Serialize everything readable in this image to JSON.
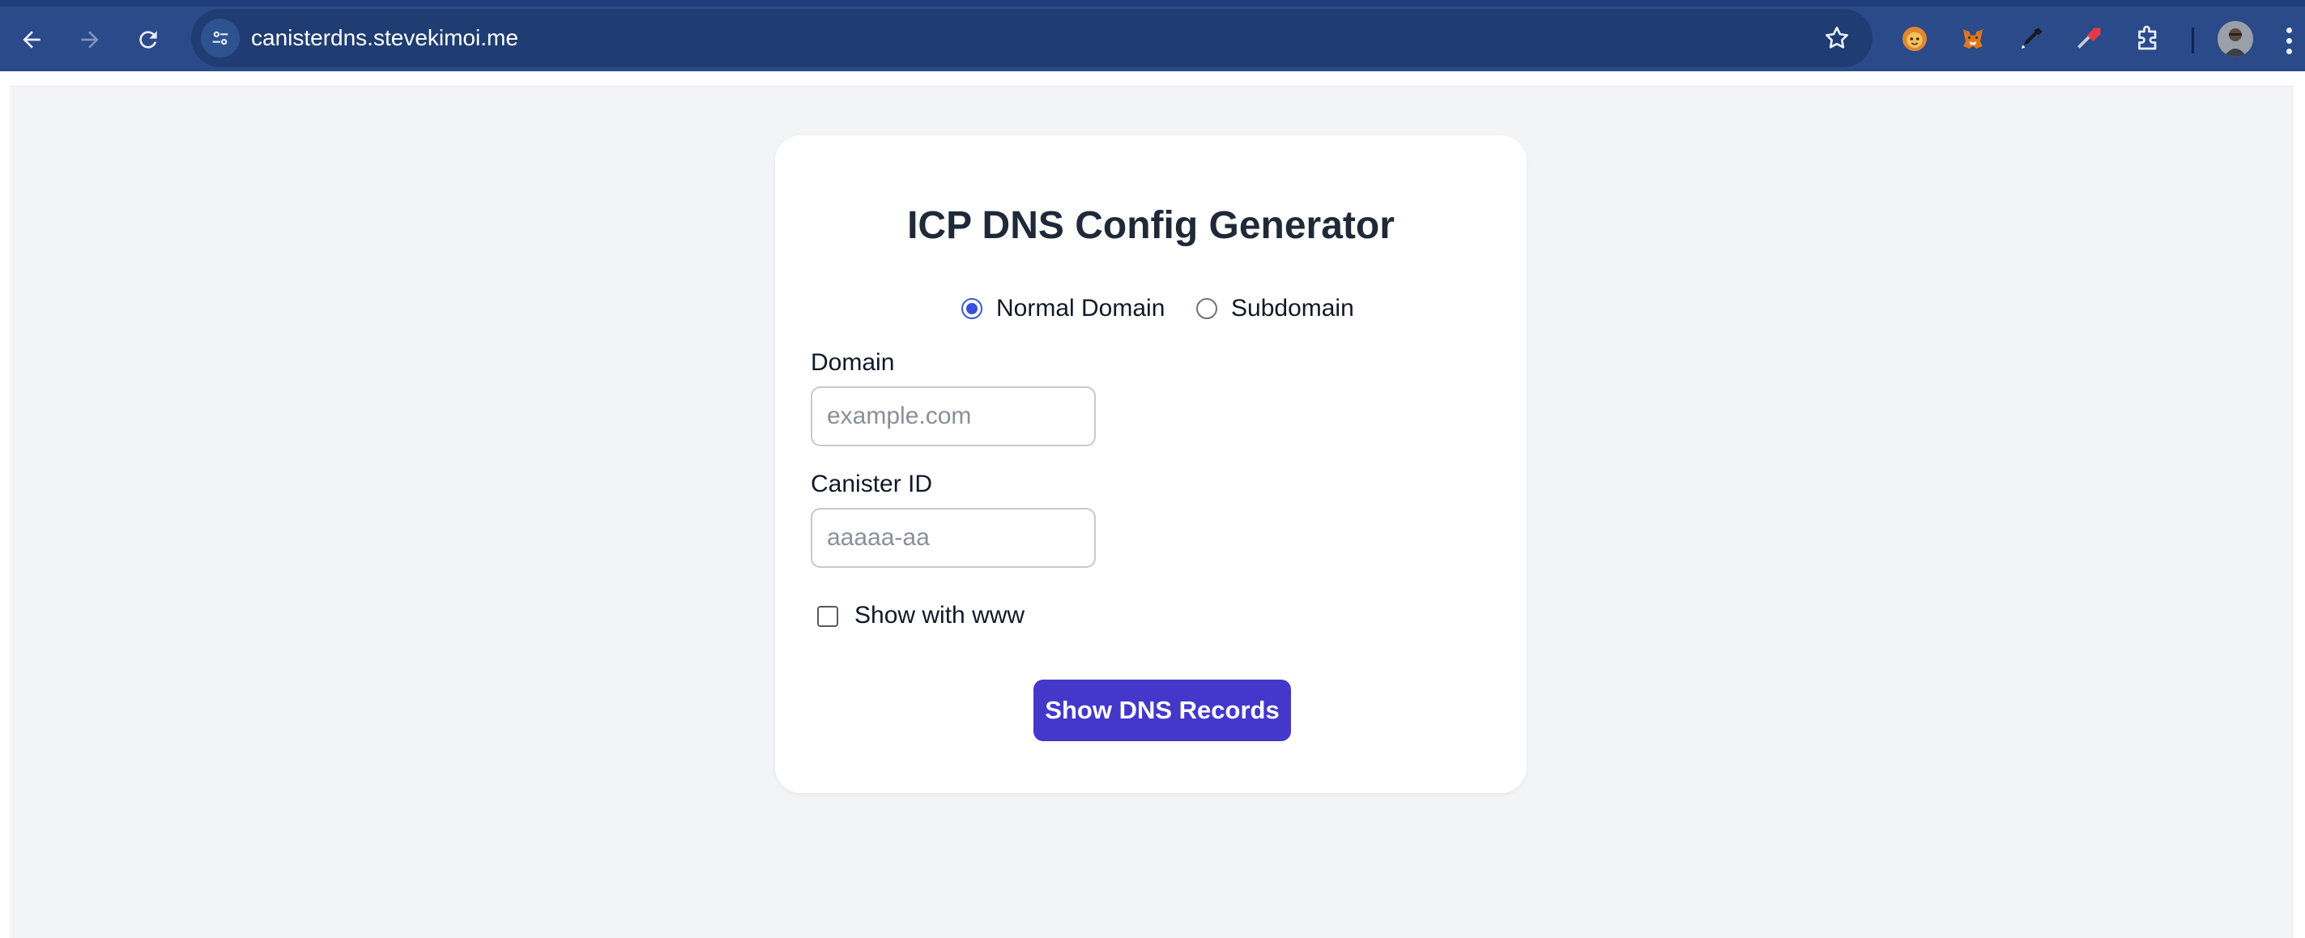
{
  "browser": {
    "url": "canisterdns.stevekimoi.me",
    "extensions": [
      "fox-face-icon",
      "metamask-fox-icon",
      "eyedropper-icon",
      "highlighter-icon",
      "puzzle-piece-icon"
    ]
  },
  "colors": {
    "toolbar_bg": "#2a4a8a",
    "omnibox_bg": "#1f3d72",
    "page_bg": "#f3f4f6",
    "card_bg": "#ffffff",
    "accent": "#4338ca",
    "radio_accent": "#3b4fd8"
  },
  "form": {
    "title": "ICP DNS Config Generator",
    "domain_type": {
      "options": [
        {
          "label": "Normal Domain",
          "checked": true
        },
        {
          "label": "Subdomain",
          "checked": false
        }
      ]
    },
    "domain": {
      "label": "Domain",
      "value": "",
      "placeholder": "example.com"
    },
    "canister": {
      "label": "Canister ID",
      "value": "",
      "placeholder": "aaaaa-aa"
    },
    "www_checkbox": {
      "label": "Show with www",
      "checked": false
    },
    "submit_label": "Show DNS Records"
  }
}
